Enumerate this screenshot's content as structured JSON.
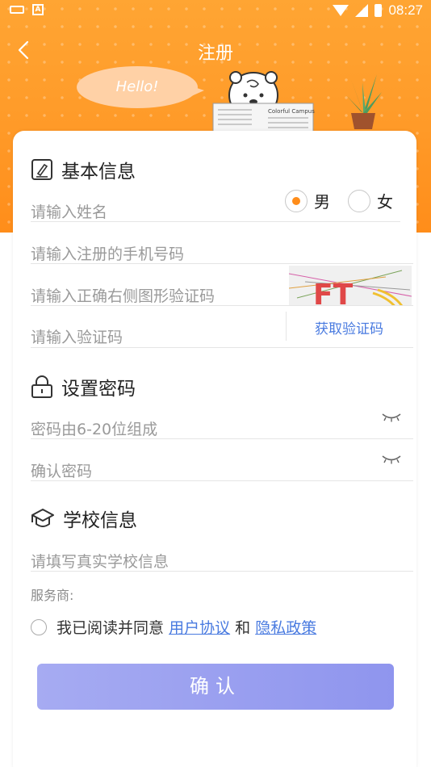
{
  "status_bar": {
    "time": "08:27"
  },
  "header": {
    "title": "注册",
    "bubble_text": "Hello!",
    "newspaper_text": "Colorful Campus"
  },
  "basic_info": {
    "heading": "基本信息",
    "name_placeholder": "请输入姓名",
    "gender_options": [
      "男",
      "女"
    ],
    "gender_selected": "男",
    "phone_placeholder": "请输入注册的手机号码",
    "captcha_placeholder": "请输入正确右侧图形验证码",
    "captcha_text": "FT",
    "code_placeholder": "请输入验证码",
    "get_code_label": "获取验证码"
  },
  "password": {
    "heading": "设置密码",
    "password_placeholder": "密码由6-20位组成",
    "confirm_placeholder": "确认密码"
  },
  "school": {
    "heading": "学校信息",
    "school_placeholder": "请填写真实学校信息",
    "provider_label": "服务商:"
  },
  "agreement": {
    "prefix": "我已阅读并同意",
    "user_agreement": "用户协议",
    "and": "和",
    "privacy_policy": "隐私政策"
  },
  "confirm_button": "确认",
  "colors": {
    "header": "#ff9a28",
    "accent": "#ff8d1a",
    "link": "#4a7be0",
    "button": "#979cf0"
  },
  "icons": [
    "keyboard-icon",
    "a-icon",
    "wifi-icon",
    "signal-icon",
    "battery-icon",
    "back-arrow-icon",
    "edit-form-icon",
    "lock-icon",
    "graduation-cap-icon",
    "eye-closed-icon"
  ]
}
